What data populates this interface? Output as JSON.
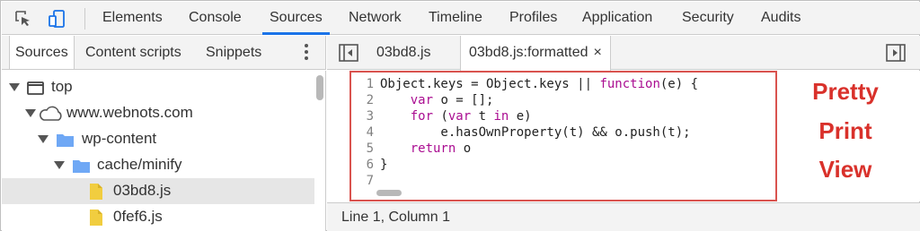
{
  "toolbar": {
    "icons": [
      "inspect-cursor-icon",
      "device-toolbar-icon"
    ],
    "tabs": [
      "Elements",
      "Console",
      "Sources",
      "Network",
      "Timeline",
      "Profiles",
      "Application",
      "Security",
      "Audits"
    ],
    "active_tab": "Sources",
    "accent_color": "#1a73e8"
  },
  "navigator": {
    "tabs": [
      "Sources",
      "Content scripts",
      "Snippets"
    ],
    "active_tab": "Sources",
    "tree": [
      {
        "label": "top",
        "icon": "frame-icon",
        "expanded": true
      },
      {
        "label": "www.webnots.com",
        "icon": "cloud-icon",
        "expanded": true
      },
      {
        "label": "wp-content",
        "icon": "folder-icon",
        "expanded": true
      },
      {
        "label": "cache/minify",
        "icon": "folder-icon",
        "expanded": true
      },
      {
        "label": "03bd8.js",
        "icon": "file-icon",
        "selected": true
      },
      {
        "label": "0fef6.js",
        "icon": "file-icon"
      }
    ]
  },
  "editor": {
    "tabs": [
      {
        "label": "03bd8.js",
        "active": false
      },
      {
        "label": "03bd8.js:formatted",
        "active": true,
        "close": "×"
      }
    ],
    "line_numbers": [
      "1",
      "2",
      "3",
      "4",
      "5",
      "6",
      "7"
    ],
    "code": [
      [
        {
          "t": "Object.keys = Object.keys || "
        },
        {
          "t": "function",
          "k": true
        },
        {
          "t": "(e) {"
        }
      ],
      [
        {
          "t": "    "
        },
        {
          "t": "var",
          "k": true
        },
        {
          "t": " o = [];"
        }
      ],
      [
        {
          "t": "    "
        },
        {
          "t": "for",
          "k": true
        },
        {
          "t": " ("
        },
        {
          "t": "var",
          "k": true
        },
        {
          "t": " t "
        },
        {
          "t": "in",
          "k": true
        },
        {
          "t": " e)"
        }
      ],
      [
        {
          "t": "        e.hasOwnProperty(t) && o.push(t);"
        }
      ],
      [
        {
          "t": "    "
        },
        {
          "t": "return",
          "k": true
        },
        {
          "t": " o"
        }
      ],
      [
        {
          "t": "}"
        }
      ],
      []
    ],
    "keyword_color": "#aa0d91"
  },
  "status_bar": {
    "position": "Line 1, Column 1"
  },
  "annotation": {
    "lines": [
      "Pretty",
      "Print",
      "View"
    ],
    "color": "#d9312b",
    "box_color": "#d9534f"
  }
}
